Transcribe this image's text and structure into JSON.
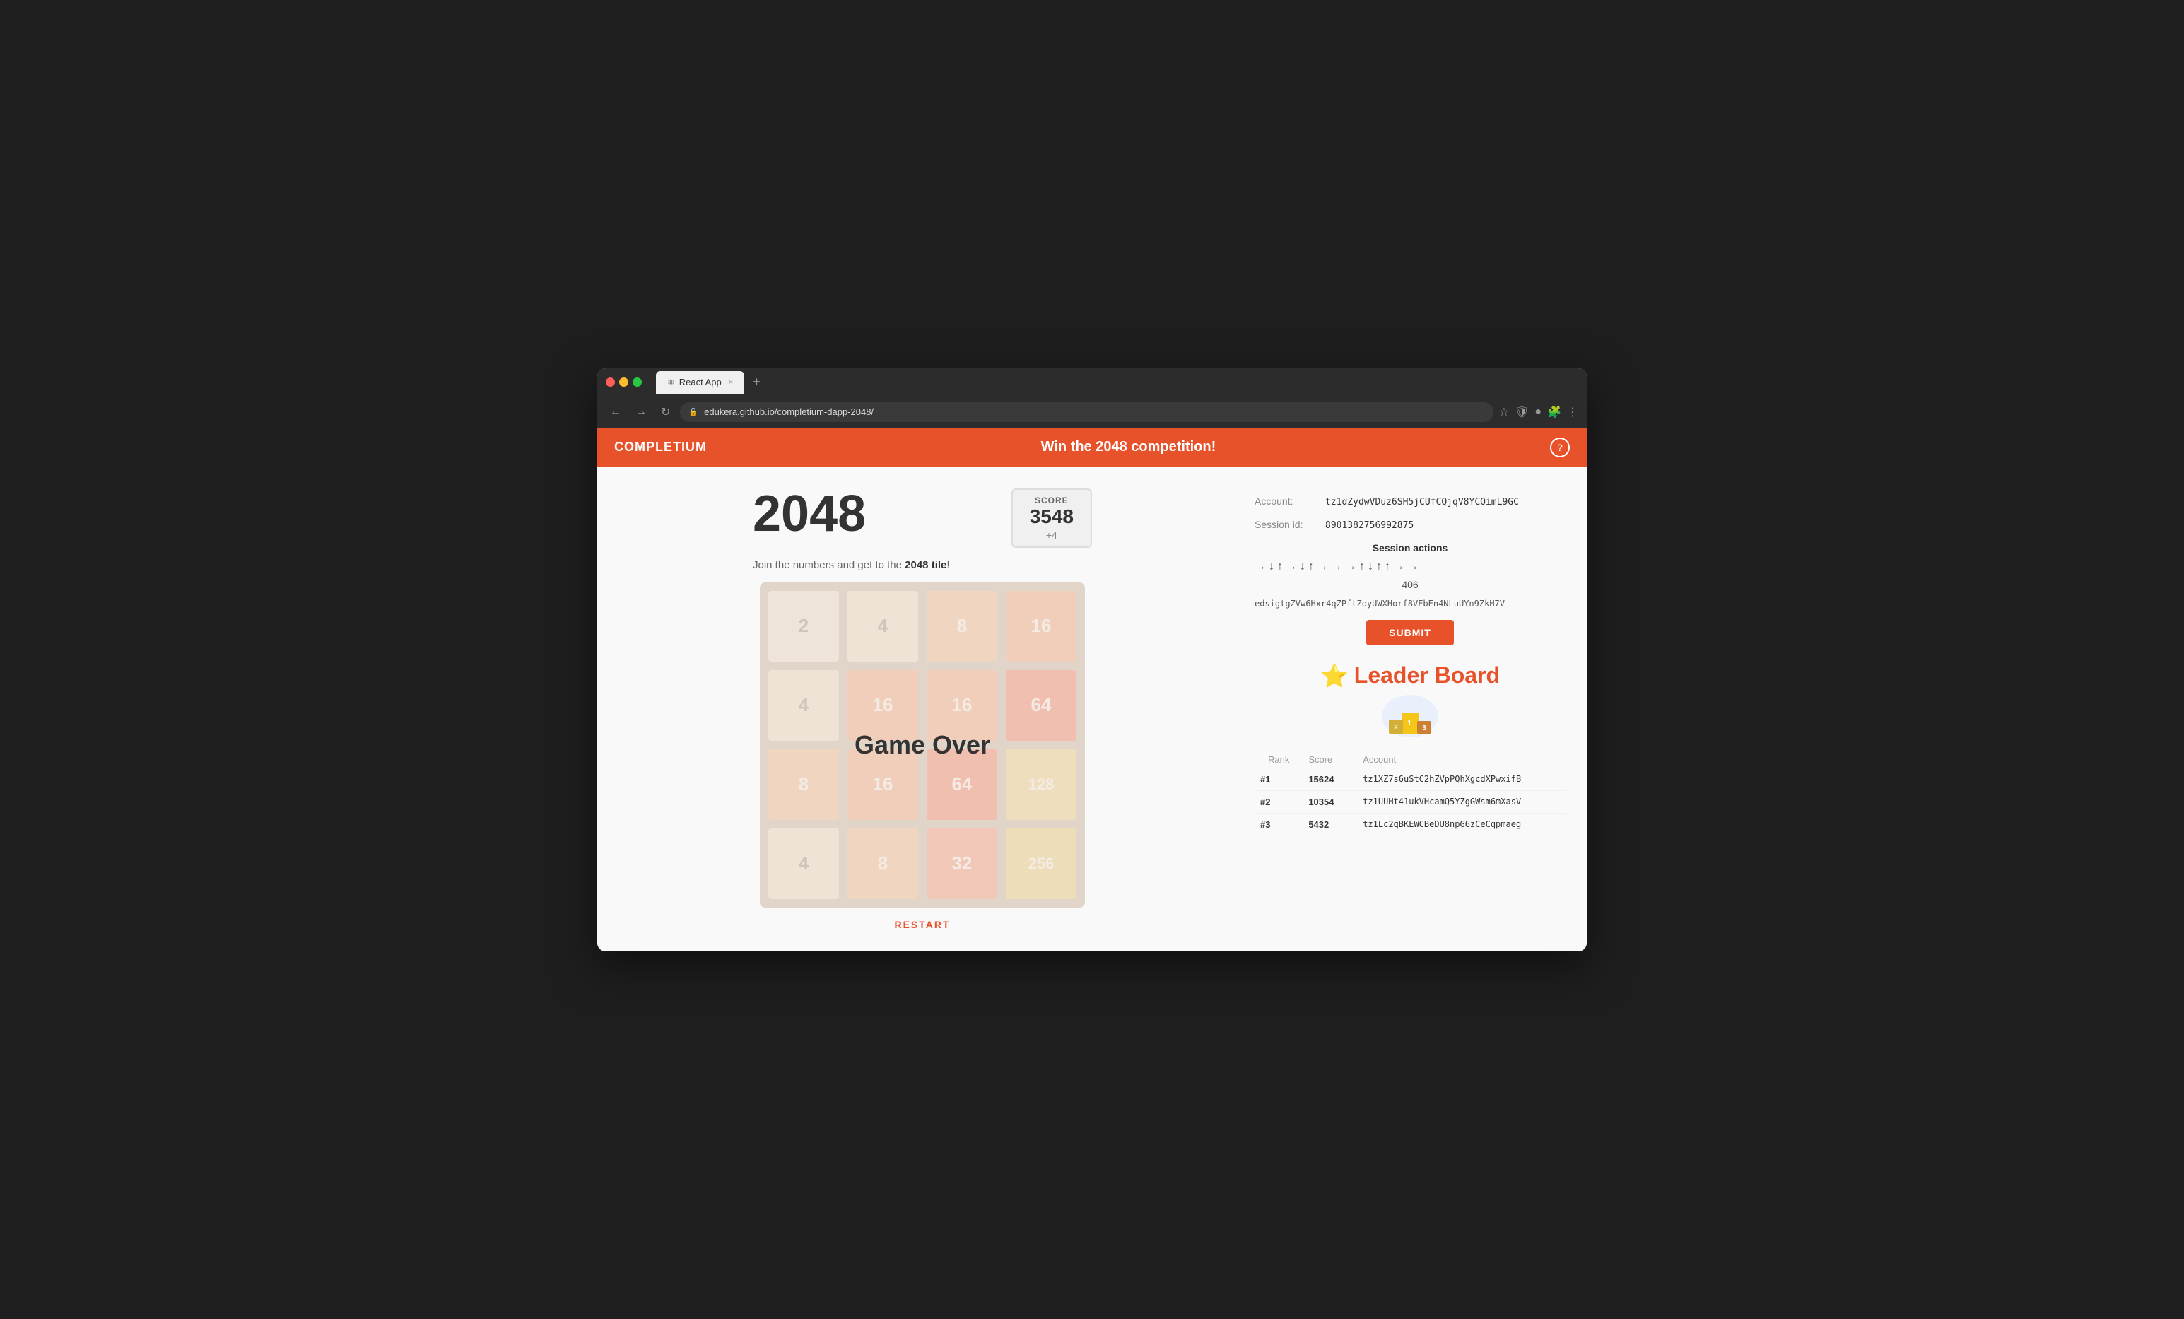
{
  "browser": {
    "tab_title": "React App",
    "tab_close": "×",
    "new_tab": "+",
    "url": "edukera.github.io/completium-dapp-2048/",
    "nav_back": "←",
    "nav_forward": "→",
    "nav_reload": "↻"
  },
  "header": {
    "logo": "Completium",
    "title": "Win the 2048 competition!",
    "help_icon": "?"
  },
  "game": {
    "title": "2048",
    "subtitle_prefix": "Join the numbers and get to the ",
    "subtitle_bold": "2048 tile",
    "subtitle_suffix": "!",
    "score_label": "SCORE",
    "score_value": "3548",
    "score_delta": "+4",
    "game_over_text": "Game Over",
    "restart_label": "RESTART",
    "grid": [
      {
        "value": "2",
        "class": "tile-2"
      },
      {
        "value": "4",
        "class": "tile-4"
      },
      {
        "value": "8",
        "class": "tile-8"
      },
      {
        "value": "16",
        "class": "tile-16"
      },
      {
        "value": "4",
        "class": "tile-4"
      },
      {
        "value": "16",
        "class": "tile-16"
      },
      {
        "value": "16",
        "class": "tile-16"
      },
      {
        "value": "64",
        "class": "tile-64"
      },
      {
        "value": "8",
        "class": "tile-8"
      },
      {
        "value": "16",
        "class": "tile-16"
      },
      {
        "value": "64",
        "class": "tile-64"
      },
      {
        "value": "128",
        "class": "tile-128"
      },
      {
        "value": "4",
        "class": "tile-4"
      },
      {
        "value": "8",
        "class": "tile-8"
      },
      {
        "value": "32",
        "class": "tile-32"
      },
      {
        "value": "256",
        "class": "tile-256"
      }
    ]
  },
  "panel": {
    "account_label": "Account:",
    "account_value": "tz1dZydwVDuz6SH5jCUfCQjqV8YCQimL9GC",
    "session_label": "Session id:",
    "session_value": "8901382756992875",
    "session_actions_title": "Session actions",
    "arrows": [
      "→",
      "↓",
      "↑",
      "→",
      "↓",
      "↑",
      "→",
      "→",
      "→",
      "↑",
      "↓",
      "↑",
      "↑",
      "→",
      "→"
    ],
    "session_count": "406",
    "session_hash": "edsigtgZVw6Hxr4qZPftZoyUWXHorf8VEbEn4NLuUYn9ZkH7V",
    "submit_label": "SUBMIT",
    "leaderboard_title": "Leader Board",
    "lb_col_rank": "Rank",
    "lb_col_score": "Score",
    "lb_col_account": "Account",
    "lb_rows": [
      {
        "rank": "#1",
        "score": "15624",
        "account": "tz1XZ7s6uStC2hZVpPQhXgcdXPwxifB"
      },
      {
        "rank": "#2",
        "score": "10354",
        "account": "tz1UUHt41ukVHcamQ5YZgGWsm6mXasV"
      },
      {
        "rank": "#3",
        "score": "5432",
        "account": "tz1Lc2qBKEWCBeDU8npG6zCeCqpmaeg"
      }
    ]
  }
}
